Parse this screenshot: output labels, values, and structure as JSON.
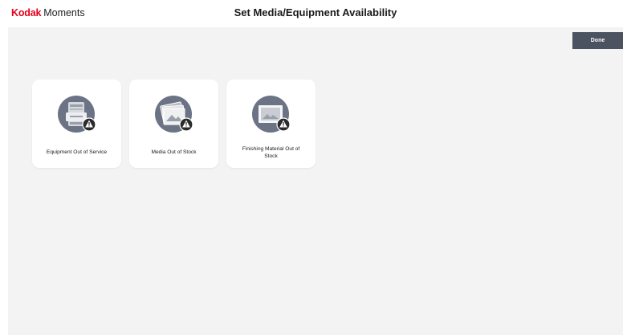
{
  "header": {
    "brand_primary": "Kodak",
    "brand_secondary": "Moments",
    "title": "Set Media/Equipment Availability"
  },
  "toolbar": {
    "done_label": "Done"
  },
  "tiles": [
    {
      "label": "Equipment Out of Service",
      "icon": "printer-warning-icon"
    },
    {
      "label": "Media Out of Stock",
      "icon": "photo-stack-warning-icon"
    },
    {
      "label": "Finishing Material Out of Stock",
      "icon": "frame-warning-icon"
    }
  ],
  "colors": {
    "brand_red": "#e3001b",
    "icon_circle": "#6b7384",
    "warning_badge": "#2b2b2b",
    "done_button": "#4b5260",
    "background": "#f3f3f3"
  }
}
